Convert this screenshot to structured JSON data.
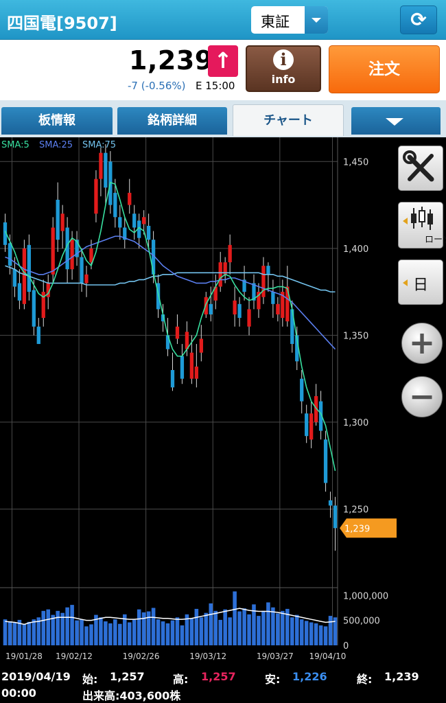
{
  "header": {
    "stock_title": "四国電[9507]",
    "market": "東証",
    "refresh_icon": "refresh-icon"
  },
  "quote": {
    "price": "1,239",
    "change": "-7 (-0.56%)",
    "market_time": "E 15:00",
    "info_label": "info",
    "order_label": "注文"
  },
  "tabs": [
    {
      "label": "板情報"
    },
    {
      "label": "銘柄詳細"
    },
    {
      "label": "チャート"
    }
  ],
  "side_panel": {
    "candle_label": "ローソク",
    "period_label": "日"
  },
  "colors": {
    "up": "#e21b1b",
    "down": "#1e9ad6",
    "sma5": "#38e0a0",
    "sma25": "#5b7ff0",
    "sma75": "#73c3ee",
    "price_marker": "#f59a20",
    "volume": "#2d6fd6"
  },
  "chart_data": {
    "type": "candlestick",
    "legend": [
      "SMA:5",
      "SMA:25",
      "SMA:75"
    ],
    "ylim": [
      1200,
      1460
    ],
    "y_ticks": [
      {
        "value": 1450,
        "label": "1,450"
      },
      {
        "value": 1400,
        "label": "1,400"
      },
      {
        "value": 1350,
        "label": "1,350"
      },
      {
        "value": 1300,
        "label": "1,300"
      },
      {
        "value": 1250,
        "label": "1,250"
      }
    ],
    "x_labels": [
      "19/01/28",
      "19/02/12",
      "19/02/26",
      "19/03/12",
      "19/03/27",
      "19/04/10"
    ],
    "current_price": {
      "value": 1239,
      "label": "1,239"
    },
    "candles": [
      [
        1415,
        1402,
        1420,
        1398
      ],
      [
        1403,
        1390,
        1408,
        1385
      ],
      [
        1388,
        1378,
        1395,
        1372
      ],
      [
        1380,
        1370,
        1388,
        1365
      ],
      [
        1368,
        1400,
        1405,
        1365
      ],
      [
        1402,
        1375,
        1408,
        1370
      ],
      [
        1376,
        1355,
        1382,
        1350
      ],
      [
        1355,
        1345,
        1360,
        1345
      ],
      [
        1360,
        1375,
        1382,
        1355
      ],
      [
        1372,
        1380,
        1385,
        1365
      ],
      [
        1385,
        1412,
        1418,
        1380
      ],
      [
        1428,
        1405,
        1438,
        1398
      ],
      [
        1410,
        1420,
        1425,
        1400
      ],
      [
        1412,
        1388,
        1418,
        1380
      ],
      [
        1388,
        1405,
        1410,
        1382
      ],
      [
        1405,
        1395,
        1410,
        1390
      ],
      [
        1395,
        1380,
        1400,
        1375
      ],
      [
        1380,
        1385,
        1390,
        1372
      ],
      [
        1392,
        1400,
        1405,
        1388
      ],
      [
        1420,
        1440,
        1445,
        1415
      ],
      [
        1440,
        1455,
        1458,
        1430
      ],
      [
        1455,
        1435,
        1460,
        1425
      ],
      [
        1450,
        1425,
        1456,
        1420
      ],
      [
        1432,
        1418,
        1440,
        1412
      ],
      [
        1418,
        1412,
        1425,
        1405
      ],
      [
        1412,
        1405,
        1418,
        1400
      ],
      [
        1425,
        1432,
        1440,
        1420
      ],
      [
        1420,
        1412,
        1425,
        1405
      ],
      [
        1416,
        1406,
        1420,
        1400
      ],
      [
        1414,
        1418,
        1422,
        1408
      ],
      [
        1413,
        1405,
        1420,
        1400
      ],
      [
        1405,
        1385,
        1410,
        1380
      ],
      [
        1380,
        1365,
        1385,
        1360
      ],
      [
        1362,
        1358,
        1368,
        1352
      ],
      [
        1350,
        1342,
        1360,
        1338
      ],
      [
        1330,
        1320,
        1340,
        1318
      ],
      [
        1348,
        1355,
        1362,
        1345
      ],
      [
        1338,
        1325,
        1345,
        1322
      ],
      [
        1342,
        1352,
        1358,
        1338
      ],
      [
        1325,
        1340,
        1350,
        1322
      ],
      [
        1325,
        1332,
        1345,
        1320
      ],
      [
        1340,
        1348,
        1356,
        1335
      ],
      [
        1362,
        1372,
        1375,
        1360
      ],
      [
        1368,
        1362,
        1378,
        1358
      ],
      [
        1370,
        1378,
        1385,
        1365
      ],
      [
        1378,
        1392,
        1398,
        1375
      ],
      [
        1385,
        1392,
        1395,
        1380
      ],
      [
        1392,
        1402,
        1408,
        1385
      ],
      [
        1362,
        1370,
        1378,
        1355
      ],
      [
        1368,
        1360,
        1372,
        1355
      ],
      [
        1382,
        1375,
        1390,
        1370
      ],
      [
        1355,
        1365,
        1372,
        1350
      ],
      [
        1380,
        1370,
        1385,
        1365
      ],
      [
        1365,
        1375,
        1380,
        1360
      ],
      [
        1372,
        1390,
        1395,
        1368
      ],
      [
        1390,
        1385,
        1392,
        1375
      ],
      [
        1375,
        1368,
        1382,
        1360
      ],
      [
        1362,
        1368,
        1372,
        1358
      ],
      [
        1360,
        1375,
        1382,
        1355
      ],
      [
        1358,
        1378,
        1390,
        1355
      ],
      [
        1365,
        1345,
        1370,
        1340
      ],
      [
        1350,
        1335,
        1355,
        1330
      ],
      [
        1325,
        1312,
        1330,
        1305
      ],
      [
        1305,
        1292,
        1310,
        1288
      ],
      [
        1290,
        1305,
        1312,
        1285
      ],
      [
        1300,
        1315,
        1322,
        1298
      ],
      [
        1312,
        1295,
        1318,
        1290
      ],
      [
        1290,
        1265,
        1295,
        1260
      ],
      [
        1255,
        1252,
        1260,
        1245
      ],
      [
        1252,
        1239,
        1257,
        1226
      ]
    ],
    "sma5": [
      1410,
      1404,
      1398,
      1390,
      1386,
      1384,
      1379,
      1374,
      1372,
      1374,
      1380,
      1388,
      1396,
      1402,
      1406,
      1404,
      1399,
      1393,
      1390,
      1398,
      1410,
      1425,
      1438,
      1437,
      1428,
      1418,
      1411,
      1409,
      1412,
      1410,
      1400,
      1386,
      1374,
      1362,
      1350,
      1342,
      1338,
      1338,
      1342,
      1346,
      1350,
      1360,
      1368,
      1373,
      1378,
      1383,
      1385,
      1384,
      1379,
      1375,
      1372,
      1370,
      1371,
      1373,
      1376,
      1377,
      1377,
      1378,
      1378,
      1377,
      1365,
      1348,
      1332,
      1320,
      1312,
      1308,
      1305,
      1298,
      1285,
      1272
    ],
    "sma25": [
      1395,
      1394,
      1392,
      1390,
      1388,
      1387,
      1386,
      1385,
      1385,
      1386,
      1387,
      1389,
      1391,
      1393,
      1395,
      1397,
      1399,
      1401,
      1402,
      1403,
      1404,
      1405,
      1406,
      1407,
      1407,
      1406,
      1405,
      1404,
      1402,
      1400,
      1398,
      1396,
      1393,
      1390,
      1388,
      1386,
      1384,
      1383,
      1382,
      1381,
      1380,
      1380,
      1380,
      1381,
      1381,
      1382,
      1382,
      1383,
      1383,
      1382,
      1381,
      1380,
      1379,
      1378,
      1377,
      1376,
      1375,
      1374,
      1373,
      1371,
      1369,
      1366,
      1363,
      1360,
      1357,
      1354,
      1351,
      1348,
      1345,
      1342
    ],
    "sma75": [
      1390,
      1389,
      1388,
      1386,
      1385,
      1384,
      1383,
      1382,
      1381,
      1380,
      1380,
      1380,
      1380,
      1380,
      1380,
      1380,
      1380,
      1379,
      1379,
      1379,
      1379,
      1379,
      1379,
      1379,
      1380,
      1380,
      1381,
      1381,
      1382,
      1382,
      1383,
      1384,
      1384,
      1385,
      1385,
      1385,
      1386,
      1386,
      1386,
      1386,
      1386,
      1386,
      1386,
      1386,
      1386,
      1386,
      1386,
      1386,
      1386,
      1386,
      1386,
      1386,
      1386,
      1386,
      1385,
      1385,
      1385,
      1384,
      1384,
      1383,
      1382,
      1381,
      1380,
      1379,
      1378,
      1377,
      1376,
      1376,
      1375,
      1375
    ],
    "volume_ticks": [
      {
        "value": 1000000,
        "label": "1,000,000"
      },
      {
        "value": 500000,
        "label": "500,000"
      },
      {
        "value": 0,
        "label": "0"
      }
    ],
    "volume_max": 1100000,
    "volumes": [
      520000,
      480000,
      460000,
      510000,
      430000,
      470000,
      520000,
      560000,
      690000,
      720000,
      610000,
      690000,
      650000,
      760000,
      810000,
      500000,
      520000,
      380000,
      420000,
      610000,
      560000,
      480000,
      440000,
      520000,
      430000,
      620000,
      460000,
      510000,
      720000,
      660000,
      680000,
      750000,
      520000,
      480000,
      440000,
      500000,
      560000,
      400000,
      620000,
      540000,
      730000,
      560000,
      650000,
      840000,
      690000,
      510000,
      720000,
      560000,
      1080000,
      680000,
      740000,
      620000,
      820000,
      590000,
      690000,
      860000,
      760000,
      640000,
      690000,
      730000,
      560000,
      610000,
      520000,
      490000,
      460000,
      440000,
      400000,
      380000,
      590000,
      560000
    ],
    "volume_ma": [
      480000,
      470000,
      460000,
      440000,
      420000,
      450000,
      470000,
      480000,
      500000,
      520000,
      540000,
      560000,
      560000,
      560000,
      560000,
      540000,
      520000,
      500000,
      500000,
      520000,
      540000,
      560000,
      560000,
      550000,
      540000,
      530000,
      520000,
      520000,
      530000,
      540000,
      560000,
      560000,
      550000,
      540000,
      540000,
      530000,
      520000,
      520000,
      530000,
      540000,
      560000,
      580000,
      600000,
      620000,
      640000,
      660000,
      680000,
      700000,
      720000,
      740000,
      720000,
      700000,
      690000,
      680000,
      680000,
      680000,
      670000,
      660000,
      640000,
      620000,
      600000,
      580000,
      560000,
      540000,
      520000,
      500000,
      480000,
      460000,
      470000,
      480000
    ]
  },
  "footer": {
    "date": "2019/04/19",
    "time": "00:00",
    "open_label": "始:",
    "open": "1,257",
    "high_label": "高:",
    "high": "1,257",
    "low_label": "安:",
    "low": "1,226",
    "close_label": "終:",
    "close": "1,239",
    "volume_text": "出来高:403,600株"
  }
}
